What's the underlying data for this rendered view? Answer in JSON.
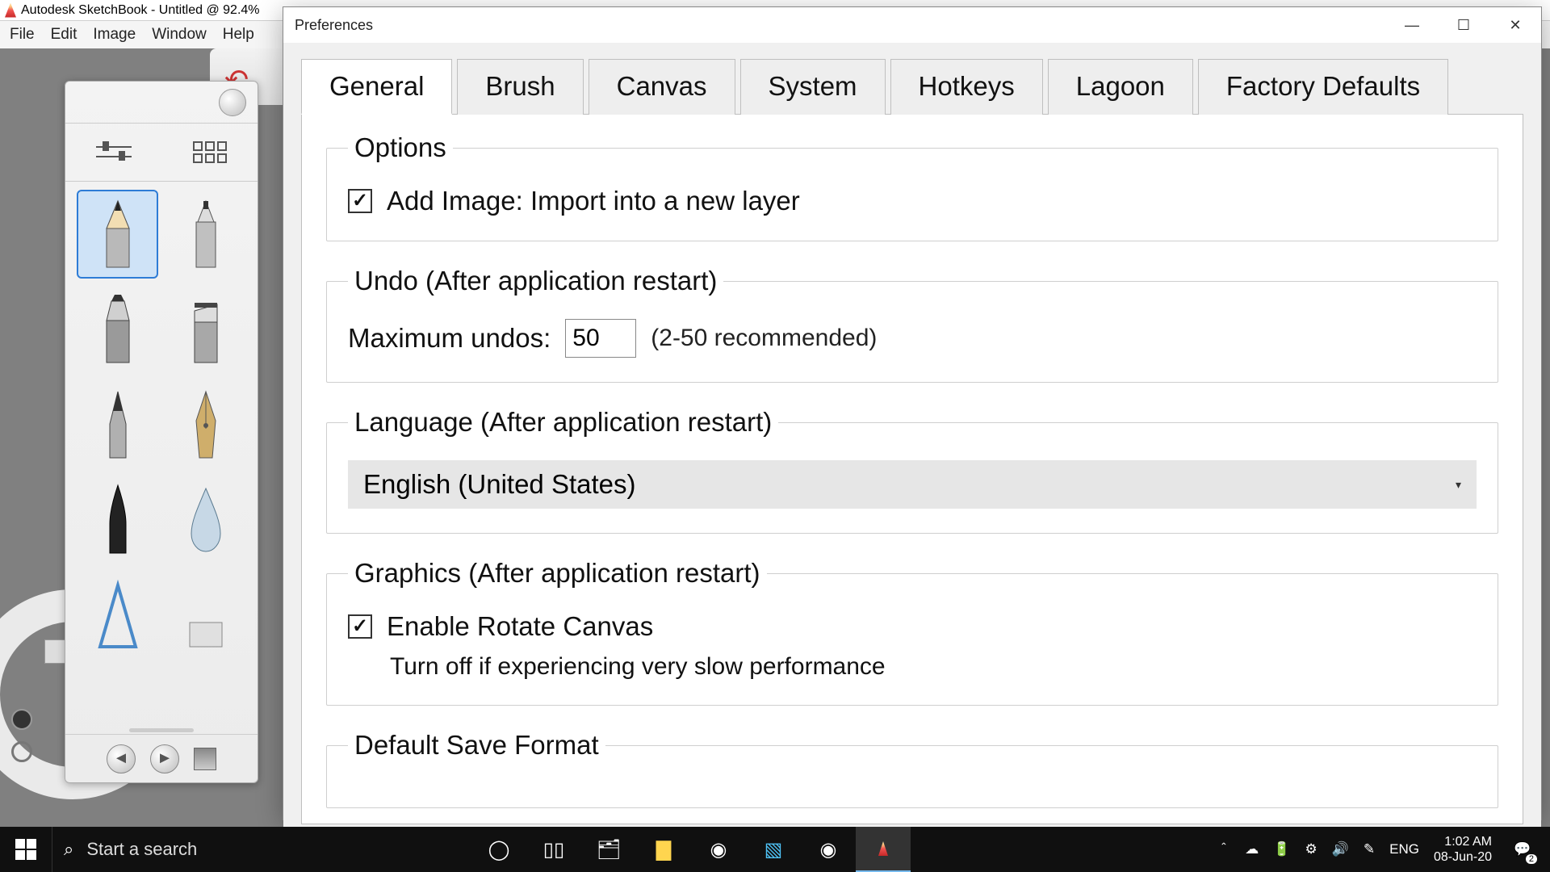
{
  "app": {
    "title": "Autodesk SketchBook - Untitled @ 92.4%",
    "menu": [
      "File",
      "Edit",
      "Image",
      "Window",
      "Help"
    ]
  },
  "brush_panel": {
    "brushes": [
      {
        "name": "pencil",
        "selected": true
      },
      {
        "name": "technical-pen",
        "selected": false
      },
      {
        "name": "chisel-marker",
        "selected": false
      },
      {
        "name": "flat-chisel",
        "selected": false
      },
      {
        "name": "ballpoint",
        "selected": false
      },
      {
        "name": "nib-pen",
        "selected": false
      },
      {
        "name": "brush-tip",
        "selected": false
      },
      {
        "name": "ink-drop",
        "selected": false
      },
      {
        "name": "soft-triangle",
        "selected": false
      },
      {
        "name": "flat-wash",
        "selected": false
      }
    ]
  },
  "preferences": {
    "dialog_title": "Preferences",
    "tabs": [
      "General",
      "Brush",
      "Canvas",
      "System",
      "Hotkeys",
      "Lagoon",
      "Factory Defaults"
    ],
    "active_tab": "General",
    "general": {
      "options": {
        "legend": "Options",
        "add_image_label": "Add Image: Import into a new layer",
        "add_image_checked": true
      },
      "undo": {
        "legend": "Undo (After application restart)",
        "label": "Maximum undos:",
        "value": "50",
        "hint": "(2-50 recommended)"
      },
      "language": {
        "legend": "Language (After application restart)",
        "value": "English (United States)"
      },
      "graphics": {
        "legend": "Graphics (After application restart)",
        "rotate_label": "Enable Rotate Canvas",
        "rotate_checked": true,
        "rotate_hint": "Turn off if experiencing very slow performance"
      },
      "save_format": {
        "legend": "Default Save Format"
      }
    }
  },
  "taskbar": {
    "search_placeholder": "Start a search",
    "lang": "ENG",
    "time": "1:02 AM",
    "date": "08-Jun-20",
    "notif_count": "2"
  }
}
